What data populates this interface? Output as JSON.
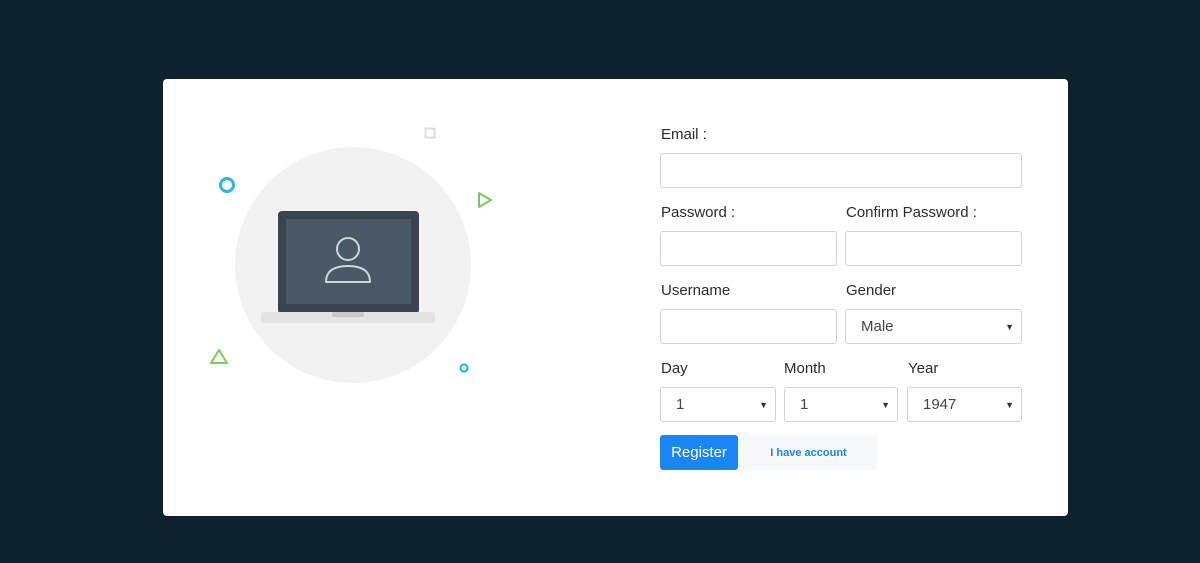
{
  "colors": {
    "background": "#0d222e",
    "card": "#ffffff",
    "primary": "#1a86f6",
    "accent_blue": "#2bb6e6",
    "accent_green": "#7ac95b"
  },
  "illustration": {
    "icon": "laptop-user-icon"
  },
  "form": {
    "email": {
      "label": "Email :",
      "value": "",
      "placeholder": ""
    },
    "password": {
      "label": "Password :",
      "value": "",
      "placeholder": ""
    },
    "confirm_password": {
      "label": "Confirm Password :",
      "value": "",
      "placeholder": ""
    },
    "username": {
      "label": "Username",
      "value": "",
      "placeholder": ""
    },
    "gender": {
      "label": "Gender",
      "selected": "Male"
    },
    "day": {
      "label": "Day",
      "selected": "1"
    },
    "month": {
      "label": "Month",
      "selected": "1"
    },
    "year": {
      "label": "Year",
      "selected": "1947"
    },
    "register_label": "Register",
    "account_label": "I have account"
  }
}
